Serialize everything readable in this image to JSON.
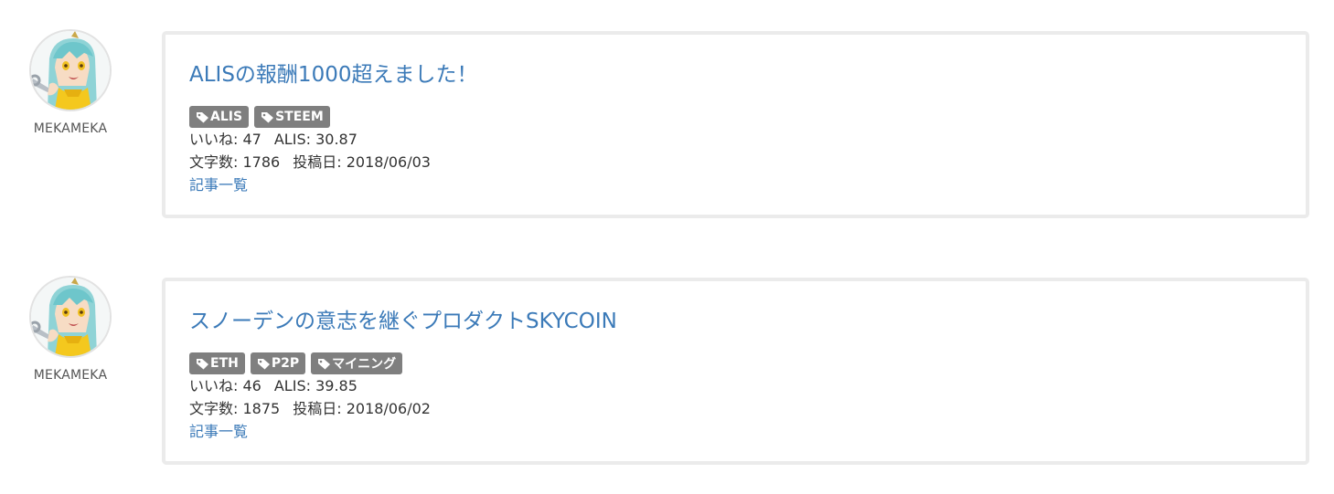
{
  "articles": [
    {
      "author": "MEKAMEKA",
      "title": "ALISの報酬1000超えました！",
      "tags": [
        "ALIS",
        "STEEM"
      ],
      "likes_label": "いいね:",
      "likes": "47",
      "alis_label": "ALIS:",
      "alis": "30.87",
      "chars_label": "文字数:",
      "chars": "1786",
      "date_label": "投稿日:",
      "date": "2018/06/03",
      "list_link": "記事一覧"
    },
    {
      "author": "MEKAMEKA",
      "title": "スノーデンの意志を継ぐプロダクトSKYCOIN",
      "tags": [
        "ETH",
        "P2P",
        "マイニング"
      ],
      "likes_label": "いいね:",
      "likes": "46",
      "alis_label": "ALIS:",
      "alis": "39.85",
      "chars_label": "文字数:",
      "chars": "1875",
      "date_label": "投稿日:",
      "date": "2018/06/02",
      "list_link": "記事一覧"
    }
  ],
  "icons": {
    "tag": "tag-icon",
    "avatar": "avatar-image"
  },
  "colors": {
    "link": "#3b7ab8",
    "tag_bg": "#7f7f7f",
    "card_border": "#ebebeb"
  }
}
